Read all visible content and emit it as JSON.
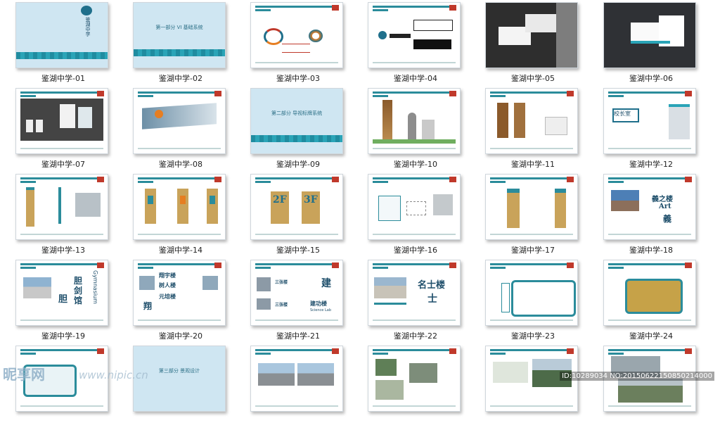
{
  "gallery": {
    "items": [
      {
        "caption": "鉴湖中学-01"
      },
      {
        "caption": "鉴湖中学-02"
      },
      {
        "caption": "鉴湖中学-03"
      },
      {
        "caption": "鉴湖中学-04"
      },
      {
        "caption": "鉴湖中学-05"
      },
      {
        "caption": "鉴湖中学-06"
      },
      {
        "caption": "鉴湖中学-07"
      },
      {
        "caption": "鉴湖中学-08"
      },
      {
        "caption": "鉴湖中学-09"
      },
      {
        "caption": "鉴湖中学-10"
      },
      {
        "caption": "鉴湖中学-11"
      },
      {
        "caption": "鉴湖中学-12"
      },
      {
        "caption": "鉴湖中学-13"
      },
      {
        "caption": "鉴湖中学-14"
      },
      {
        "caption": "鉴湖中学-15"
      },
      {
        "caption": "鉴湖中学-16"
      },
      {
        "caption": "鉴湖中学-17"
      },
      {
        "caption": "鉴湖中学-18"
      },
      {
        "caption": "鉴湖中学-19"
      },
      {
        "caption": "鉴湖中学-20"
      },
      {
        "caption": "鉴湖中学-21"
      },
      {
        "caption": "鉴湖中学-22"
      },
      {
        "caption": "鉴湖中学-23"
      },
      {
        "caption": "鉴湖中学-24"
      },
      {
        "caption": ""
      },
      {
        "caption": ""
      },
      {
        "caption": ""
      },
      {
        "caption": ""
      },
      {
        "caption": ""
      },
      {
        "caption": ""
      }
    ]
  },
  "slides": {
    "s02_text": "第一部分   VI 基础系统",
    "s09_text": "第二部分   导视标牌系统",
    "s27_text": "第三部分   景观设计",
    "s12_sign": "校长室",
    "s15_floor_a": "2F",
    "s15_floor_b": "3F",
    "s18_line1": "義之楼",
    "s18_line2": "Art",
    "s18_line3": "義",
    "s19_main": "胆剑馆",
    "s19_side": "Gymnasium",
    "s19_char": "胆",
    "s20_a": "翔宇楼",
    "s20_b": "树人楼",
    "s20_c": "元培楼",
    "s20_char": "翔",
    "s20_right": "元树翔\n培人宇\n楼楼楼",
    "s21_a": "三张楼",
    "s21_b": "三张楼",
    "s21_c": "建功楼",
    "s21_d": "Science Lab",
    "s21_char": "建",
    "s22_title": "名士楼",
    "s22_char": "士",
    "s01_vertical": "鉴湖中学"
  },
  "watermark": {
    "logo": "昵享网",
    "url": "www.nipic.cn",
    "id": "ID:10289034 NO:20150622150850214000"
  },
  "colors": {
    "teal": "#2b8c9b",
    "cover_bg": "#cfe6f2",
    "dark_bg": "#3a3a3a",
    "brand_red": "#c0392b"
  }
}
